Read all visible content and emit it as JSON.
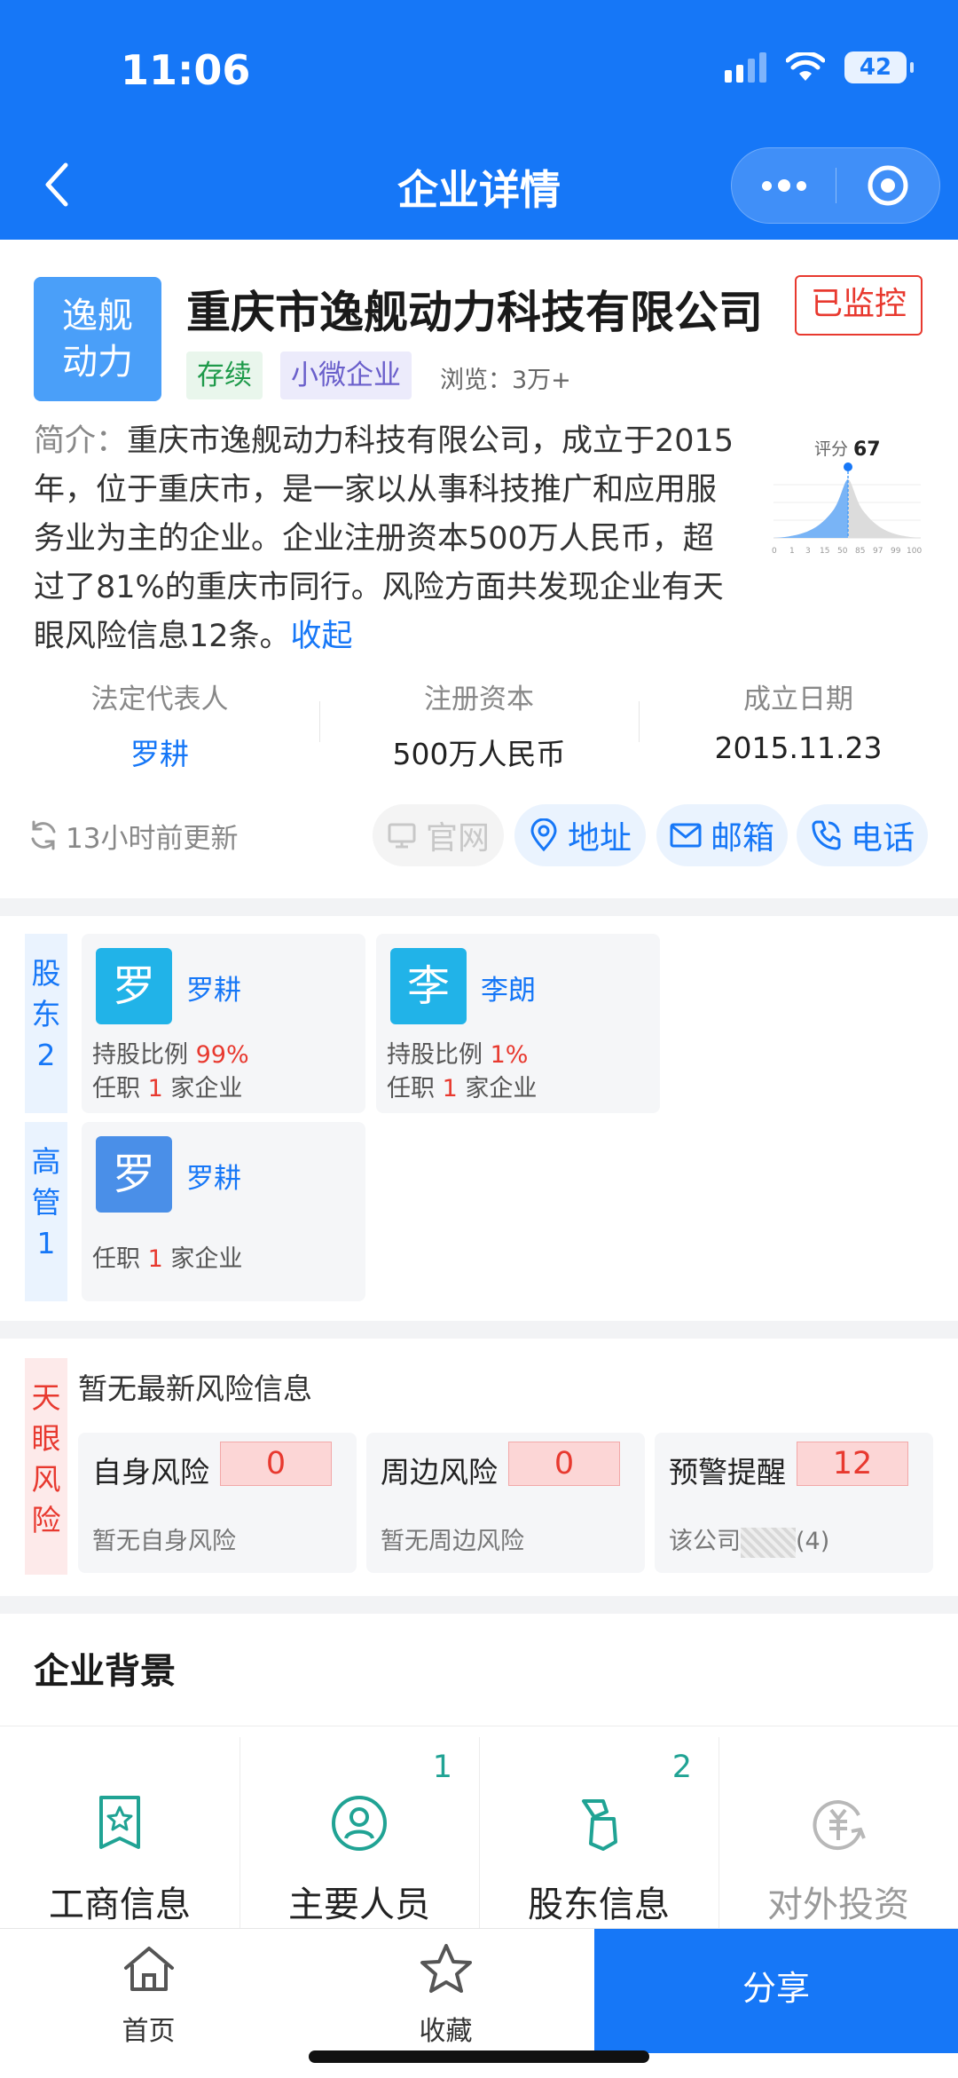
{
  "status_bar": {
    "time": "11:06",
    "battery": "42"
  },
  "nav": {
    "title": "企业详情"
  },
  "company": {
    "logo_text": [
      "逸舰",
      "动力"
    ],
    "name": "重庆市逸舰动力科技有限公司",
    "monitor_label": "已监控",
    "tags": [
      "存续",
      "小微企业"
    ],
    "views": "浏览：3万+",
    "intro_label": "简介：",
    "intro_text": "重庆市逸舰动力科技有限公司，成立于2015年，位于重庆市，是一家以从事科技推广和应用服务业为主的企业。企业注册资本500万人民币，超过了81%的重庆市同行。风险方面共发现企业有天眼风险信息12条。",
    "intro_fold": "收起",
    "score_label": "评分",
    "score_value": "67",
    "score_ticks": [
      "0",
      "1",
      "3",
      "15",
      "50",
      "85",
      "97",
      "99",
      "100"
    ]
  },
  "key_info": [
    {
      "label": "法定代表人",
      "value": "罗耕"
    },
    {
      "label": "注册资本",
      "value": "500万人民币"
    },
    {
      "label": "成立日期",
      "value": "2015.11.23"
    }
  ],
  "update": {
    "text": "13小时前更新"
  },
  "actions": {
    "website": "官网",
    "address": "地址",
    "email": "邮箱",
    "phone": "电话"
  },
  "shareholders": {
    "label": [
      "股",
      "东",
      "2"
    ],
    "items": [
      {
        "avatar": "罗",
        "name": "罗耕",
        "ratio_label": "持股比例",
        "ratio": "99%",
        "job_prefix": "任职",
        "job_count": "1",
        "job_suffix": "家企业"
      },
      {
        "avatar": "李",
        "name": "李朗",
        "ratio_label": "持股比例",
        "ratio": "1%",
        "job_prefix": "任职",
        "job_count": "1",
        "job_suffix": "家企业"
      }
    ]
  },
  "executives": {
    "label": [
      "高",
      "管",
      "1"
    ],
    "items": [
      {
        "avatar": "罗",
        "name": "罗耕",
        "job_prefix": "任职",
        "job_count": "1",
        "job_suffix": "家企业"
      }
    ]
  },
  "risk": {
    "label": [
      "天",
      "眼",
      "风",
      "险"
    ],
    "headline": "暂无最新风险信息",
    "cards": [
      {
        "title": "自身风险",
        "count": "0",
        "desc": "暂无自身风险"
      },
      {
        "title": "周边风险",
        "count": "0",
        "desc": "暂无周边风险"
      },
      {
        "title": "预警提醒",
        "count": "12",
        "desc_prefix": "该公司",
        "desc_suffix": "(4)"
      }
    ]
  },
  "background": {
    "title": "企业背景",
    "items": [
      {
        "label": "工商信息",
        "count": ""
      },
      {
        "label": "主要人员",
        "count": "1"
      },
      {
        "label": "股东信息",
        "count": "2"
      },
      {
        "label": "对外投资",
        "count": ""
      }
    ]
  },
  "tabbar": {
    "home": "首页",
    "favorite": "收藏",
    "share": "分享"
  },
  "colors": {
    "primary": "#1677f7",
    "danger": "#e8392f",
    "teal": "#20a394"
  }
}
